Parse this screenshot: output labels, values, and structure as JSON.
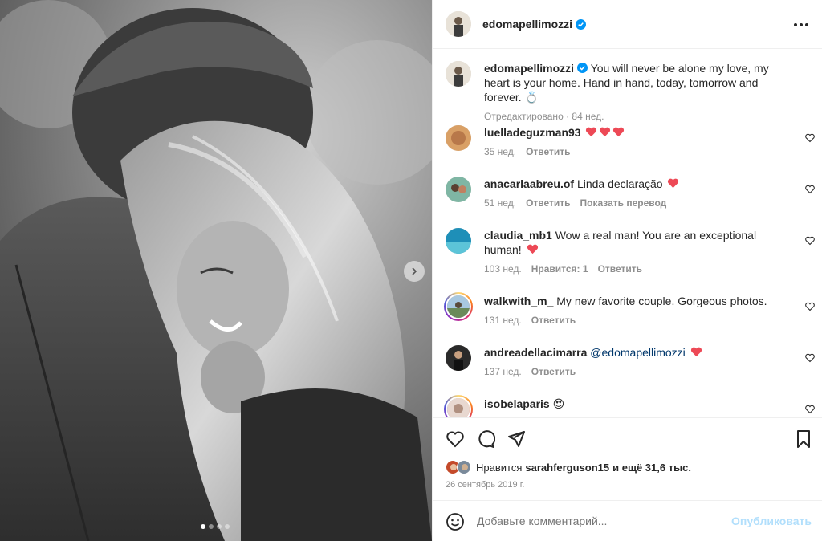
{
  "photo": {
    "carousel_dots": 4,
    "active_dot": 0
  },
  "header": {
    "username": "edomapellimozzi",
    "verified": true
  },
  "caption": {
    "username": "edomapellimozzi",
    "text": "You will never be alone my love, my heart is your home. Hand in hand, today, tomorrow and forever. 💍",
    "edited_label": "Отредактировано",
    "time": "84 нед."
  },
  "comments": [
    {
      "username": "luelladeguzman93",
      "text": "",
      "hearts": 3,
      "time": "35 нед.",
      "reply": "Ответить"
    },
    {
      "username": "anacarlaabreu.of",
      "text": "Linda declaração",
      "hearts": 1,
      "time": "51 нед.",
      "reply": "Ответить",
      "translate": "Показать перевод"
    },
    {
      "username": "claudia_mb1",
      "text": "Wow a real man! You are an exceptional human!",
      "hearts": 1,
      "time": "103 нед.",
      "likes": "Нравится: 1",
      "reply": "Ответить"
    },
    {
      "username": "walkwith_m_",
      "text": "My new favorite couple. Gorgeous photos.",
      "time": "131 нед.",
      "reply": "Ответить"
    },
    {
      "username": "andreadellacimarra",
      "mention": "@edomapellimozzi",
      "hearts": 1,
      "time": "137 нед.",
      "reply": "Ответить"
    },
    {
      "username": "isobelaparis",
      "text": "😍"
    }
  ],
  "likes": {
    "prefix": "Нравится",
    "user": "sarahferguson15",
    "suffix": "и ещё 31,6 тыс."
  },
  "date": "26 сентябрь 2019 г.",
  "add_comment": {
    "placeholder": "Добавьте комментарий...",
    "post_label": "Опубликовать"
  },
  "colors": {
    "link_blue": "#00376b",
    "post_button": "#b2dffc",
    "verified": "#0095f6",
    "heart_red": "#ed4956",
    "muted": "#8e8e8e"
  }
}
